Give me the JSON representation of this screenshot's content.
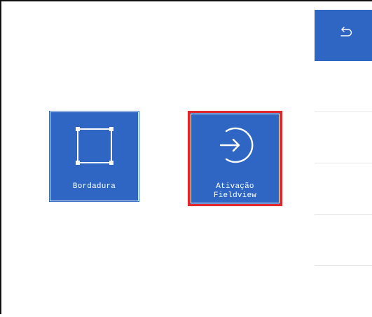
{
  "colors": {
    "tile_blue": "#2f66c4",
    "selected_border": "#e0262a",
    "frame": "#111111",
    "divider": "#e6e6e6"
  },
  "tiles": [
    {
      "label": "Bordadura",
      "icon": "square-frame-icon",
      "selected": false
    },
    {
      "label_line1": "Ativação",
      "label_line2": "Fieldview",
      "icon": "sign-in-arrow-icon",
      "selected": true
    }
  ],
  "sidebar": {
    "back_icon": "undo-back-arrow-icon",
    "slots": 4
  }
}
